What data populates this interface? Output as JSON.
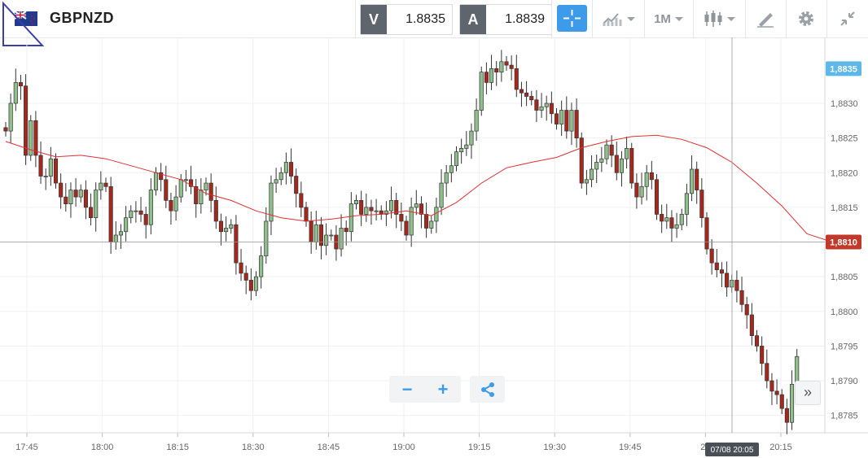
{
  "instrument": {
    "symbol": "GBPNZD"
  },
  "quotes": {
    "bid_label": "V",
    "bid": "1.8835",
    "ask_label": "A",
    "ask": "1.8839"
  },
  "toolbar": {
    "crosshair_icon": "crosshair-icon",
    "indicators_icon": "indicators-icon",
    "timeframe": "1M",
    "chart_type_icon": "candlestick-icon",
    "draw_icon": "pencil-icon",
    "settings_icon": "gear-icon",
    "collapse_icon": "collapse-icon"
  },
  "colors": {
    "bull": "#8fbf8a",
    "bear": "#a5281c",
    "ma": "#e03030",
    "accent": "#3d9be9",
    "current_price": "#5db7e8",
    "crosshair_label": "#c0392b"
  },
  "chart_data": {
    "type": "candlestick",
    "x_tick_labels": [
      "17:45",
      "18:00",
      "18:15",
      "18:30",
      "18:45",
      "19:00",
      "19:15",
      "19:30",
      "19:45",
      "20",
      "20:15"
    ],
    "y_tick_labels": [
      "1,8830",
      "1,8825",
      "1,8820",
      "1,8815",
      "1,8810",
      "1,8805",
      "1,8800",
      "1,8795",
      "1,8790",
      "1,8785"
    ],
    "ylim": [
      1.87825,
      1.88395
    ],
    "last_price_label": "1,8835",
    "crosshair_price_label": "1,8810",
    "crosshair_price": 1.881,
    "crosshair_time_label": "07/08 20:05",
    "ma_points": [
      [
        0,
        1.88245
      ],
      [
        5,
        1.88233
      ],
      [
        10,
        1.88223
      ],
      [
        15,
        1.88225
      ],
      [
        20,
        1.8822
      ],
      [
        25,
        1.8821
      ],
      [
        30,
        1.882
      ],
      [
        35,
        1.8819
      ],
      [
        40,
        1.8817
      ],
      [
        45,
        1.8816
      ],
      [
        50,
        1.88145
      ],
      [
        55,
        1.88135
      ],
      [
        60,
        1.8813
      ],
      [
        65,
        1.88133
      ],
      [
        70,
        1.88138
      ],
      [
        75,
        1.8814
      ],
      [
        80,
        1.88145
      ],
      [
        85,
        1.88138
      ],
      [
        90,
        1.88157
      ],
      [
        95,
        1.88185
      ],
      [
        100,
        1.88207
      ],
      [
        105,
        1.88215
      ],
      [
        110,
        1.88222
      ],
      [
        115,
        1.88236
      ],
      [
        120,
        1.88245
      ],
      [
        125,
        1.88252
      ],
      [
        130,
        1.88254
      ],
      [
        135,
        1.88248
      ],
      [
        140,
        1.88236
      ],
      [
        145,
        1.88215
      ],
      [
        150,
        1.88185
      ],
      [
        155,
        1.88152
      ],
      [
        160,
        1.88112
      ],
      [
        165,
        1.881
      ]
    ],
    "candle_closes": [
      1.8826,
      1.883,
      1.8833,
      1.88325,
      1.88225,
      1.88275,
      1.88225,
      1.88195,
      1.88195,
      1.8822,
      1.88185,
      1.88165,
      1.88155,
      1.88175,
      1.88165,
      1.88175,
      1.8815,
      1.88135,
      1.88175,
      1.88185,
      1.8818,
      1.881,
      1.8811,
      1.88115,
      1.88135,
      1.88145,
      1.88145,
      1.8814,
      1.88125,
      1.88175,
      1.882,
      1.8819,
      1.8816,
      1.88145,
      1.88165,
      1.8819,
      1.8819,
      1.8818,
      1.88155,
      1.88175,
      1.88185,
      1.8816,
      1.8813,
      1.88115,
      1.8812,
      1.88125,
      1.8807,
      1.88055,
      1.88045,
      1.8803,
      1.8805,
      1.8808,
      1.8813,
      1.88185,
      1.8819,
      1.882,
      1.88215,
      1.88195,
      1.8817,
      1.8815,
      1.8813,
      1.881,
      1.88125,
      1.88095,
      1.8811,
      1.8811,
      1.8809,
      1.8812,
      1.88115,
      1.88155,
      1.8816,
      1.8814,
      1.8815,
      1.88145,
      1.88145,
      1.8814,
      1.88145,
      1.8816,
      1.8814,
      1.8813,
      1.8811,
      1.8815,
      1.88155,
      1.8814,
      1.8812,
      1.8813,
      1.8815,
      1.88185,
      1.882,
      1.8821,
      1.8823,
      1.88235,
      1.8824,
      1.8826,
      1.8829,
      1.88345,
      1.8833,
      1.8835,
      1.88345,
      1.8836,
      1.88355,
      1.8835,
      1.8832,
      1.88315,
      1.8831,
      1.88305,
      1.8829,
      1.88295,
      1.883,
      1.88285,
      1.8827,
      1.8829,
      1.8826,
      1.8829,
      1.8825,
      1.88185,
      1.8819,
      1.88205,
      1.88215,
      1.8822,
      1.8824,
      1.88225,
      1.882,
      1.8822,
      1.88235,
      1.88185,
      1.88165,
      1.8818,
      1.882,
      1.8819,
      1.8814,
      1.8813,
      1.88135,
      1.8812,
      1.88125,
      1.8814,
      1.8817,
      1.88205,
      1.88175,
      1.88135,
      1.8809,
      1.8807,
      1.8806,
      1.88055,
      1.88035,
      1.88045,
      1.8803,
      1.8801,
      1.87995,
      1.87965,
      1.8795,
      1.87925,
      1.879,
      1.87885,
      1.8788,
      1.8786,
      1.8784,
      1.87895,
      1.87935
    ]
  }
}
